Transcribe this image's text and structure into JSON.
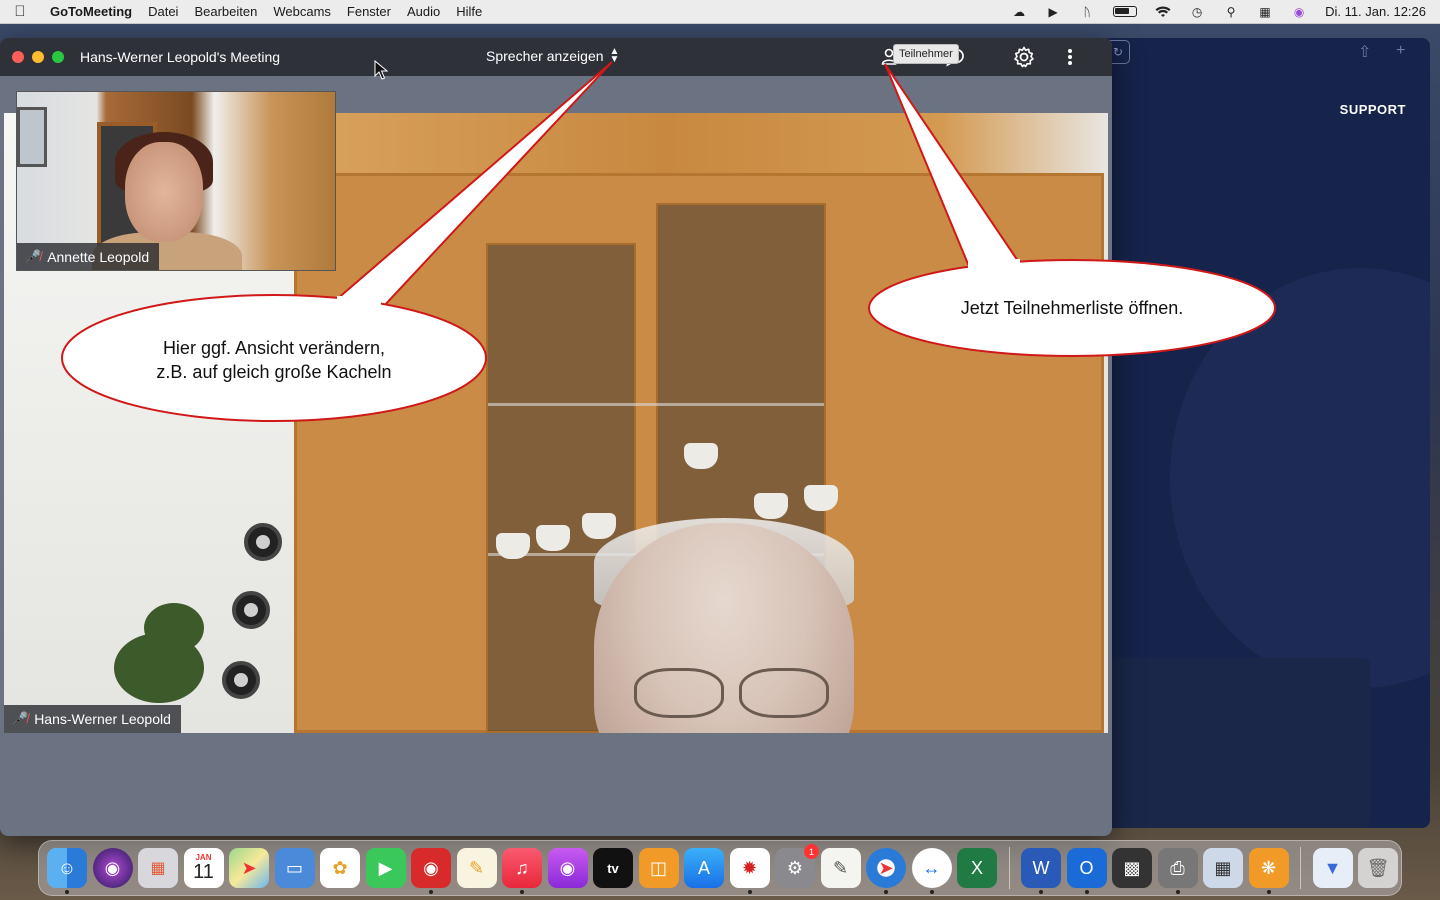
{
  "menubar": {
    "app": "GoToMeeting",
    "items": [
      "Datei",
      "Bearbeiten",
      "Webcams",
      "Fenster",
      "Audio",
      "Hilfe"
    ],
    "datetime": "Di. 11. Jan.  12:26"
  },
  "background_window": {
    "support": "SUPPORT"
  },
  "meeting": {
    "title": "Hans-Werner Leopold's Meeting",
    "view_selector": "Sprecher anzeigen",
    "participant_count": "2",
    "tooltip": "Teilnehmer",
    "main_speaker": "Hans-Werner Leopold",
    "self_tile_name": "Annette Leopold"
  },
  "callouts": {
    "view_line1": "Hier ggf. Ansicht verändern,",
    "view_line2": "z.B. auf gleich große Kacheln",
    "participants": "Jetzt Teilnehmerliste öffnen."
  },
  "dock": {
    "calendar_month": "JAN",
    "calendar_day": "11",
    "tv_label": "tv",
    "settings_badge": "1",
    "apps": [
      "finder-icon",
      "siri-icon",
      "launchpad-icon",
      "calendar-icon",
      "maps-icon",
      "keynote-icon",
      "photos-icon",
      "facetime-icon",
      "photobooth-icon",
      "pages-icon",
      "music-icon",
      "podcasts-icon",
      "appletv-icon",
      "books-icon",
      "appstore-icon",
      "acrobat-icon",
      "systemprefs-icon",
      "textedit-icon",
      "safari-icon",
      "teamviewer-icon",
      "excel-icon",
      "word-icon",
      "outlook-icon",
      "scanner-icon",
      "printer-icon",
      "preview-icon",
      "elements-icon",
      "downloads-icon",
      "trash-icon"
    ]
  },
  "colors": {
    "titlebar": "#2f3138",
    "callout_border": "#d01818",
    "mic_off": "#f05a5a"
  }
}
